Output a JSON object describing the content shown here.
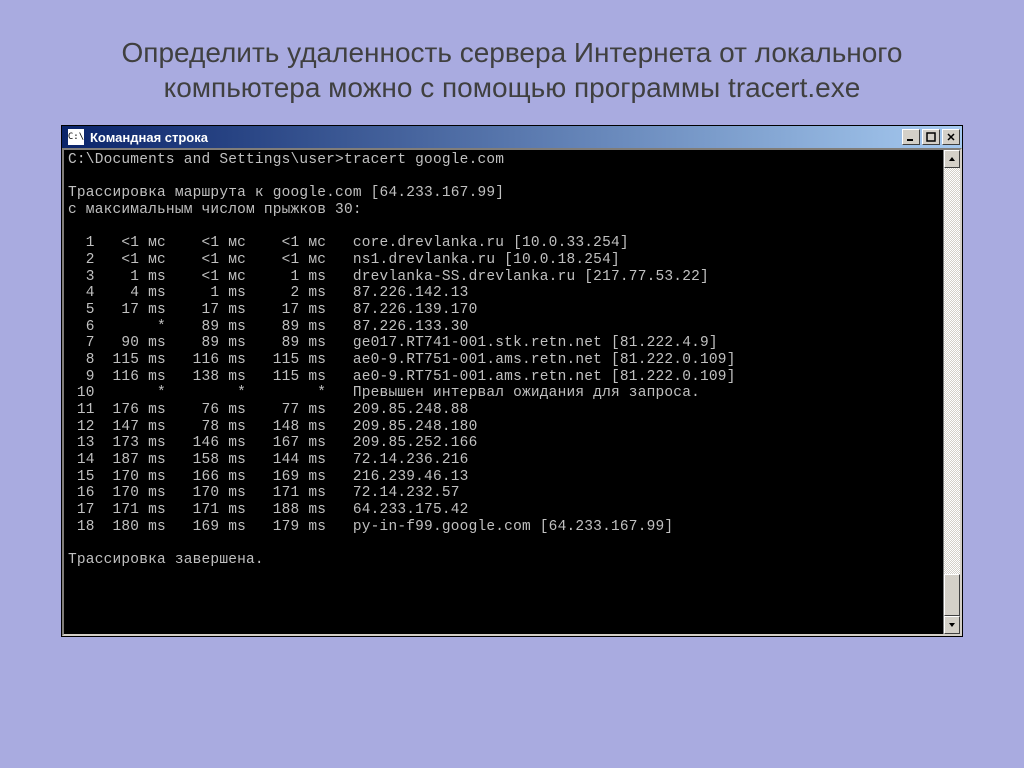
{
  "heading": "Определить удаленность сервера Интернета от локального компьютера можно с помощью программы tracert.exe",
  "window": {
    "title": "Командная строка",
    "app_icon_text": "C:\\"
  },
  "console": {
    "prompt": "C:\\Documents and Settings\\user>tracert google.com",
    "trace_header1": "Трассировка маршрута к google.com [64.233.167.99]",
    "trace_header2": "с максимальным числом прыжков 30:",
    "footer": "Трассировка завершена.",
    "hops": [
      {
        "n": 1,
        "t1": "<1 мс",
        "t2": "<1 мс",
        "t3": "<1 мс",
        "host": "core.drevlanka.ru [10.0.33.254]"
      },
      {
        "n": 2,
        "t1": "<1 мс",
        "t2": "<1 мс",
        "t3": "<1 мс",
        "host": "ns1.drevlanka.ru [10.0.18.254]"
      },
      {
        "n": 3,
        "t1": "1 ms",
        "t2": "<1 мс",
        "t3": "1 ms",
        "host": "drevlanka-SS.drevlanka.ru [217.77.53.22]"
      },
      {
        "n": 4,
        "t1": "4 ms",
        "t2": "1 ms",
        "t3": "2 ms",
        "host": "87.226.142.13"
      },
      {
        "n": 5,
        "t1": "17 ms",
        "t2": "17 ms",
        "t3": "17 ms",
        "host": "87.226.139.170"
      },
      {
        "n": 6,
        "t1": "*",
        "t2": "89 ms",
        "t3": "89 ms",
        "host": "87.226.133.30"
      },
      {
        "n": 7,
        "t1": "90 ms",
        "t2": "89 ms",
        "t3": "89 ms",
        "host": "ge017.RT741-001.stk.retn.net [81.222.4.9]"
      },
      {
        "n": 8,
        "t1": "115 ms",
        "t2": "116 ms",
        "t3": "115 ms",
        "host": "ae0-9.RT751-001.ams.retn.net [81.222.0.109]"
      },
      {
        "n": 9,
        "t1": "116 ms",
        "t2": "138 ms",
        "t3": "115 ms",
        "host": "ae0-9.RT751-001.ams.retn.net [81.222.0.109]"
      },
      {
        "n": 10,
        "t1": "*",
        "t2": "*",
        "t3": "*",
        "host": "Превышен интервал ожидания для запроса."
      },
      {
        "n": 11,
        "t1": "176 ms",
        "t2": "76 ms",
        "t3": "77 ms",
        "host": "209.85.248.88"
      },
      {
        "n": 12,
        "t1": "147 ms",
        "t2": "78 ms",
        "t3": "148 ms",
        "host": "209.85.248.180"
      },
      {
        "n": 13,
        "t1": "173 ms",
        "t2": "146 ms",
        "t3": "167 ms",
        "host": "209.85.252.166"
      },
      {
        "n": 14,
        "t1": "187 ms",
        "t2": "158 ms",
        "t3": "144 ms",
        "host": "72.14.236.216"
      },
      {
        "n": 15,
        "t1": "170 ms",
        "t2": "166 ms",
        "t3": "169 ms",
        "host": "216.239.46.13"
      },
      {
        "n": 16,
        "t1": "170 ms",
        "t2": "170 ms",
        "t3": "171 ms",
        "host": "72.14.232.57"
      },
      {
        "n": 17,
        "t1": "171 ms",
        "t2": "171 ms",
        "t3": "188 ms",
        "host": "64.233.175.42"
      },
      {
        "n": 18,
        "t1": "180 ms",
        "t2": "169 ms",
        "t3": "179 ms",
        "host": "py-in-f99.google.com [64.233.167.99]"
      }
    ]
  }
}
